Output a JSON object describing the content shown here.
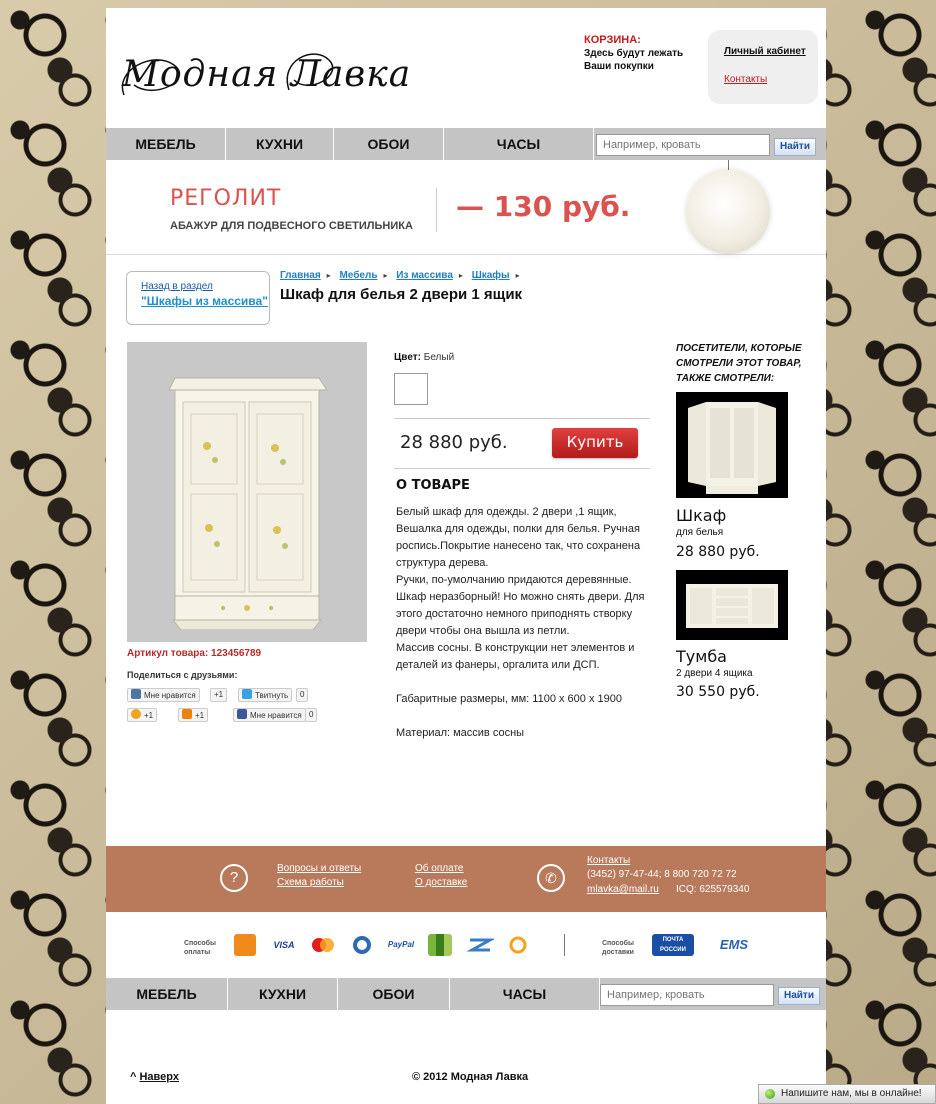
{
  "header": {
    "logo_text": "Модная Лавка",
    "cart_title": "КОРЗИНА:",
    "cart_line1": "Здесь будут лежать",
    "cart_line2": "Ваши покупки",
    "account_link": "Личный кабинет",
    "contacts_link": "Контакты"
  },
  "nav": {
    "items": [
      "МЕБЕЛЬ",
      "КУХНИ",
      "ОБОИ",
      "ЧАСЫ"
    ],
    "search_placeholder": "Например, кровать",
    "search_button": "Найти"
  },
  "promo": {
    "name": "РЕГОЛИТ",
    "desc": "АБАЖУР ДЛЯ ПОДВЕСНОГО СВЕТИЛЬНИКА",
    "price": "— 130 руб."
  },
  "breadcrumbs": {
    "back_small": "Назад в раздел",
    "back_big": "\"Шкафы из массива\"",
    "items": [
      "Главная",
      "Мебель",
      "Из массива",
      "Шкафы"
    ],
    "title": "Шкаф для белья 2 двери 1 ящик"
  },
  "product": {
    "article_label": "Артикул товара: 123456789",
    "share_label": "Поделиться с друзьями:",
    "share": {
      "vk": "Мне нравится",
      "gplus": "+1",
      "twitter": "Твитнуть",
      "twitter_count": "0",
      "mail_count": "+1",
      "ok_count": "+1",
      "fb": "Мне нравится",
      "fb_count": "0"
    },
    "color_label": "Цвет:",
    "color_value": "Белый",
    "price": "28 880 руб.",
    "buy_button": "Купить",
    "about_heading": "О ТОВАРЕ",
    "about_lines": [
      "Белый шкаф для одежды. 2 двери ,1 ящик, Вешалка для одежды, полки для белья. Ручная роспись.Покрытие нанесено так, что сохранена структура дерева.",
      "Ручки, по-умолчанию придаются деревянные.",
      "Шкаф неразборный! Но можно снять двери. Для этого достаточно немного приподнять створку двери чтобы она вышла из петли.",
      "Массив сосны. В конструкции нет элементов и деталей из фанеры, оргалита или ДСП.",
      "",
      "Габаритные размеры, мм: 1100 х 600 х 1900",
      "",
      "Материал: массив сосны"
    ]
  },
  "related": {
    "heading": "ПОСЕТИТЕЛИ, КОТОРЫЕ СМОТРЕЛИ ЭТОТ ТОВАР, ТАКЖЕ СМОТРЕЛИ:",
    "items": [
      {
        "name": "Шкаф",
        "sub": "для белья",
        "price": "28 880 руб."
      },
      {
        "name": "Тумба",
        "sub": "2 двери 4 ящика",
        "price": "30 550 руб."
      }
    ]
  },
  "footer": {
    "faq_link": "Вопросы и ответы",
    "scheme_link": "Схема работы",
    "payment_link": "Об оплате",
    "delivery_link": "О доставке",
    "contacts_link": "Контакты",
    "phone": "(3452) 97-47-44; 8 800 720 72 72",
    "email": "mlavka@mail.ru",
    "icq": "ICQ: 625579340",
    "pay_label_1": "Способы",
    "pay_label_2": "оплаты",
    "delivery_label_1": "Способы",
    "delivery_label_2": "доставки",
    "pay_icons": [
      "VISA",
      "PayPal"
    ],
    "delivery_icons": [
      "ПОЧТА РОССИИ",
      "EMS"
    ],
    "top_link": "Наверх",
    "copyright": "©   2012 Модная Лавка",
    "chat": "Напишите нам, мы в онлайне!"
  },
  "colors": {
    "accent_red": "#c41c1c",
    "promo_red": "#d9534f",
    "footer_band": "#b97a5c",
    "nav_grey": "#c4c4c4",
    "link_blue": "#1e7fc4"
  }
}
